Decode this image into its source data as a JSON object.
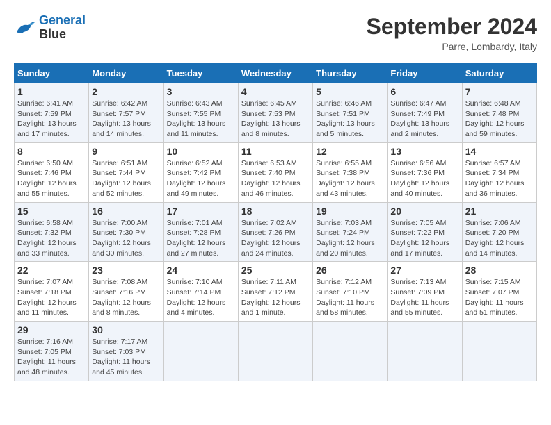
{
  "header": {
    "logo_line1": "General",
    "logo_line2": "Blue",
    "month": "September 2024",
    "location": "Parre, Lombardy, Italy"
  },
  "weekdays": [
    "Sunday",
    "Monday",
    "Tuesday",
    "Wednesday",
    "Thursday",
    "Friday",
    "Saturday"
  ],
  "weeks": [
    [
      {
        "day": "1",
        "info": "Sunrise: 6:41 AM\nSunset: 7:59 PM\nDaylight: 13 hours\nand 17 minutes."
      },
      {
        "day": "2",
        "info": "Sunrise: 6:42 AM\nSunset: 7:57 PM\nDaylight: 13 hours\nand 14 minutes."
      },
      {
        "day": "3",
        "info": "Sunrise: 6:43 AM\nSunset: 7:55 PM\nDaylight: 13 hours\nand 11 minutes."
      },
      {
        "day": "4",
        "info": "Sunrise: 6:45 AM\nSunset: 7:53 PM\nDaylight: 13 hours\nand 8 minutes."
      },
      {
        "day": "5",
        "info": "Sunrise: 6:46 AM\nSunset: 7:51 PM\nDaylight: 13 hours\nand 5 minutes."
      },
      {
        "day": "6",
        "info": "Sunrise: 6:47 AM\nSunset: 7:49 PM\nDaylight: 13 hours\nand 2 minutes."
      },
      {
        "day": "7",
        "info": "Sunrise: 6:48 AM\nSunset: 7:48 PM\nDaylight: 12 hours\nand 59 minutes."
      }
    ],
    [
      {
        "day": "8",
        "info": "Sunrise: 6:50 AM\nSunset: 7:46 PM\nDaylight: 12 hours\nand 55 minutes."
      },
      {
        "day": "9",
        "info": "Sunrise: 6:51 AM\nSunset: 7:44 PM\nDaylight: 12 hours\nand 52 minutes."
      },
      {
        "day": "10",
        "info": "Sunrise: 6:52 AM\nSunset: 7:42 PM\nDaylight: 12 hours\nand 49 minutes."
      },
      {
        "day": "11",
        "info": "Sunrise: 6:53 AM\nSunset: 7:40 PM\nDaylight: 12 hours\nand 46 minutes."
      },
      {
        "day": "12",
        "info": "Sunrise: 6:55 AM\nSunset: 7:38 PM\nDaylight: 12 hours\nand 43 minutes."
      },
      {
        "day": "13",
        "info": "Sunrise: 6:56 AM\nSunset: 7:36 PM\nDaylight: 12 hours\nand 40 minutes."
      },
      {
        "day": "14",
        "info": "Sunrise: 6:57 AM\nSunset: 7:34 PM\nDaylight: 12 hours\nand 36 minutes."
      }
    ],
    [
      {
        "day": "15",
        "info": "Sunrise: 6:58 AM\nSunset: 7:32 PM\nDaylight: 12 hours\nand 33 minutes."
      },
      {
        "day": "16",
        "info": "Sunrise: 7:00 AM\nSunset: 7:30 PM\nDaylight: 12 hours\nand 30 minutes."
      },
      {
        "day": "17",
        "info": "Sunrise: 7:01 AM\nSunset: 7:28 PM\nDaylight: 12 hours\nand 27 minutes."
      },
      {
        "day": "18",
        "info": "Sunrise: 7:02 AM\nSunset: 7:26 PM\nDaylight: 12 hours\nand 24 minutes."
      },
      {
        "day": "19",
        "info": "Sunrise: 7:03 AM\nSunset: 7:24 PM\nDaylight: 12 hours\nand 20 minutes."
      },
      {
        "day": "20",
        "info": "Sunrise: 7:05 AM\nSunset: 7:22 PM\nDaylight: 12 hours\nand 17 minutes."
      },
      {
        "day": "21",
        "info": "Sunrise: 7:06 AM\nSunset: 7:20 PM\nDaylight: 12 hours\nand 14 minutes."
      }
    ],
    [
      {
        "day": "22",
        "info": "Sunrise: 7:07 AM\nSunset: 7:18 PM\nDaylight: 12 hours\nand 11 minutes."
      },
      {
        "day": "23",
        "info": "Sunrise: 7:08 AM\nSunset: 7:16 PM\nDaylight: 12 hours\nand 8 minutes."
      },
      {
        "day": "24",
        "info": "Sunrise: 7:10 AM\nSunset: 7:14 PM\nDaylight: 12 hours\nand 4 minutes."
      },
      {
        "day": "25",
        "info": "Sunrise: 7:11 AM\nSunset: 7:12 PM\nDaylight: 12 hours\nand 1 minute."
      },
      {
        "day": "26",
        "info": "Sunrise: 7:12 AM\nSunset: 7:10 PM\nDaylight: 11 hours\nand 58 minutes."
      },
      {
        "day": "27",
        "info": "Sunrise: 7:13 AM\nSunset: 7:09 PM\nDaylight: 11 hours\nand 55 minutes."
      },
      {
        "day": "28",
        "info": "Sunrise: 7:15 AM\nSunset: 7:07 PM\nDaylight: 11 hours\nand 51 minutes."
      }
    ],
    [
      {
        "day": "29",
        "info": "Sunrise: 7:16 AM\nSunset: 7:05 PM\nDaylight: 11 hours\nand 48 minutes."
      },
      {
        "day": "30",
        "info": "Sunrise: 7:17 AM\nSunset: 7:03 PM\nDaylight: 11 hours\nand 45 minutes."
      },
      null,
      null,
      null,
      null,
      null
    ]
  ]
}
